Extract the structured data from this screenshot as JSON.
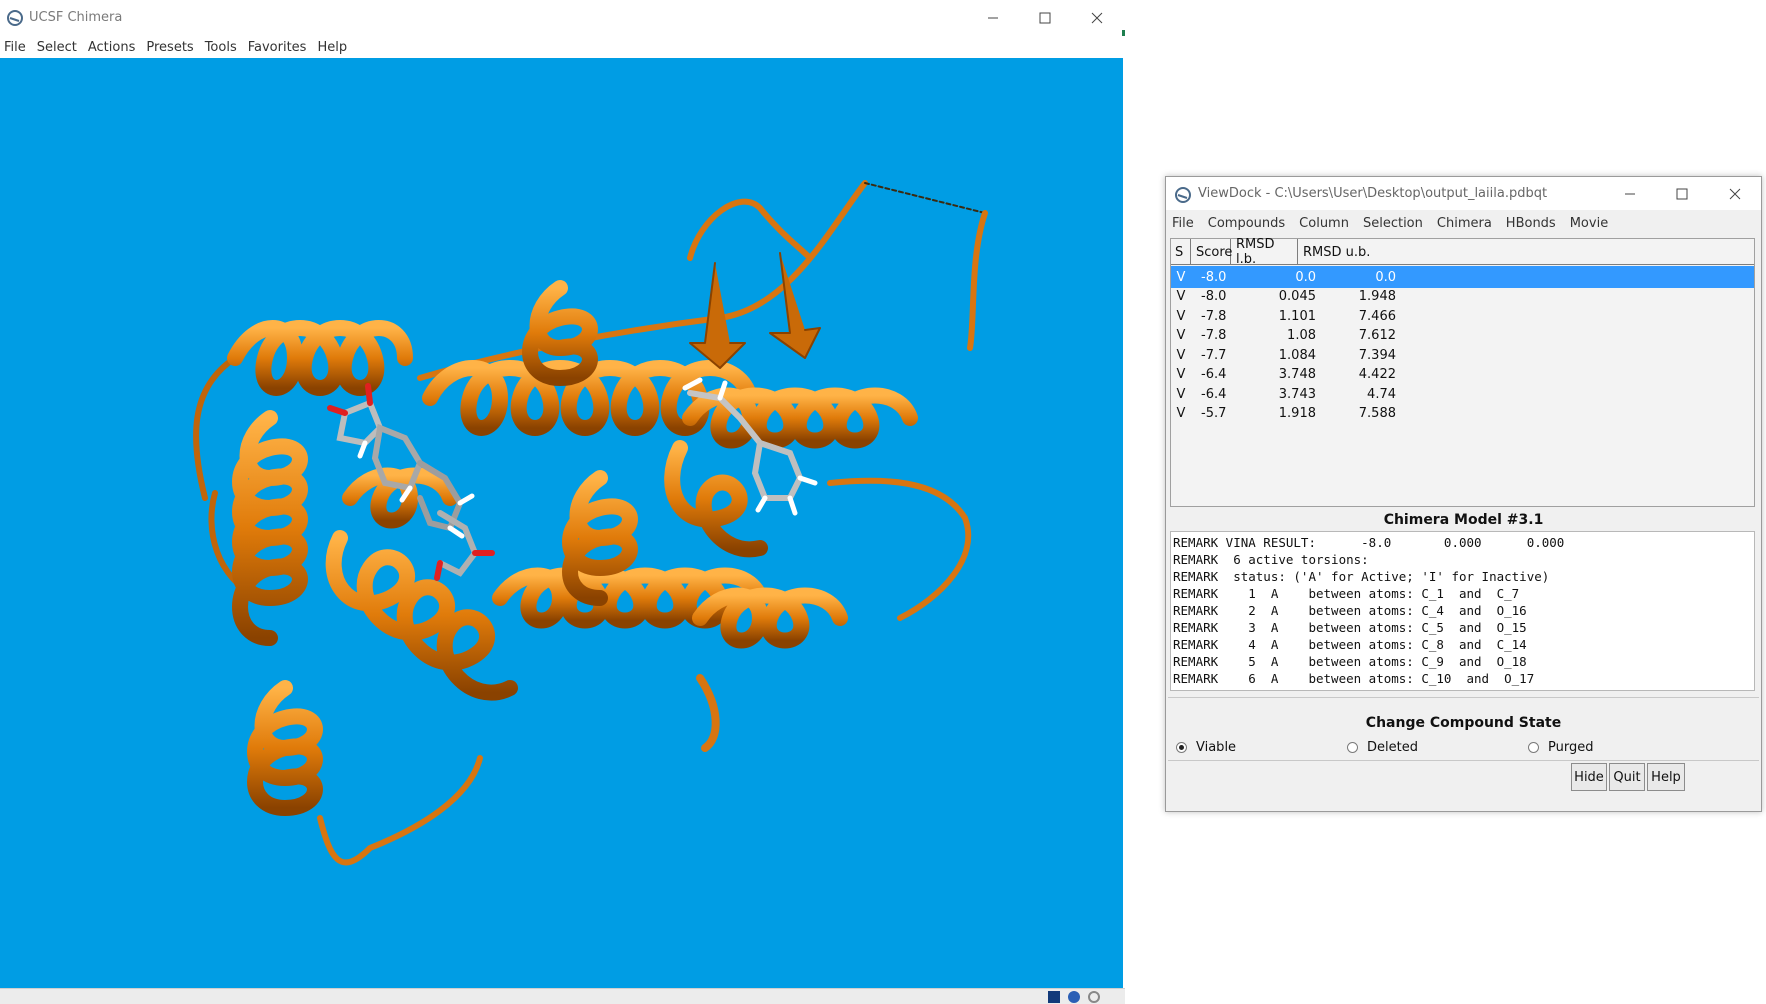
{
  "chimera": {
    "title": "UCSF Chimera",
    "menu": [
      "File",
      "Select",
      "Actions",
      "Presets",
      "Tools",
      "Favorites",
      "Help"
    ],
    "background_color": "#009de4",
    "ribbon_color": "#e07b0a"
  },
  "viewdock": {
    "title": "ViewDock - C:\\Users\\User\\Desktop\\output_laiila.pdbqt",
    "menu": [
      "File",
      "Compounds",
      "Column",
      "Selection",
      "Chimera",
      "HBonds",
      "Movie"
    ],
    "columns": [
      "S",
      "Score",
      "RMSD l.b.",
      "RMSD u.b."
    ],
    "rows": [
      {
        "s": "V",
        "score": "-8.0",
        "lb": "0.0",
        "ub": "0.0",
        "selected": true
      },
      {
        "s": "V",
        "score": "-8.0",
        "lb": "0.045",
        "ub": "1.948"
      },
      {
        "s": "V",
        "score": "-7.8",
        "lb": "1.101",
        "ub": "7.466"
      },
      {
        "s": "V",
        "score": "-7.8",
        "lb": "1.08",
        "ub": "7.612"
      },
      {
        "s": "V",
        "score": "-7.7",
        "lb": "1.084",
        "ub": "7.394"
      },
      {
        "s": "V",
        "score": "-6.4",
        "lb": "3.748",
        "ub": "4.422"
      },
      {
        "s": "V",
        "score": "-6.4",
        "lb": "3.743",
        "ub": "4.74"
      },
      {
        "s": "V",
        "score": "-5.7",
        "lb": "1.918",
        "ub": "7.588"
      }
    ],
    "model_title": "Chimera Model #3.1",
    "remarks": [
      "REMARK VINA RESULT:      -8.0       0.000      0.000",
      "REMARK  6 active torsions:",
      "REMARK  status: ('A' for Active; 'I' for Inactive)",
      "REMARK    1  A    between atoms: C_1  and  C_7",
      "REMARK    2  A    between atoms: C_4  and  O_16",
      "REMARK    3  A    between atoms: C_5  and  O_15",
      "REMARK    4  A    between atoms: C_8  and  C_14",
      "REMARK    5  A    between atoms: C_9  and  O_18",
      "REMARK    6  A    between atoms: C_10  and  O_17"
    ],
    "state_title": "Change Compound State",
    "states": {
      "viable": "Viable",
      "deleted": "Deleted",
      "purged": "Purged",
      "selected": "Viable"
    },
    "buttons": {
      "hide": "Hide",
      "quit": "Quit",
      "help": "Help"
    }
  }
}
